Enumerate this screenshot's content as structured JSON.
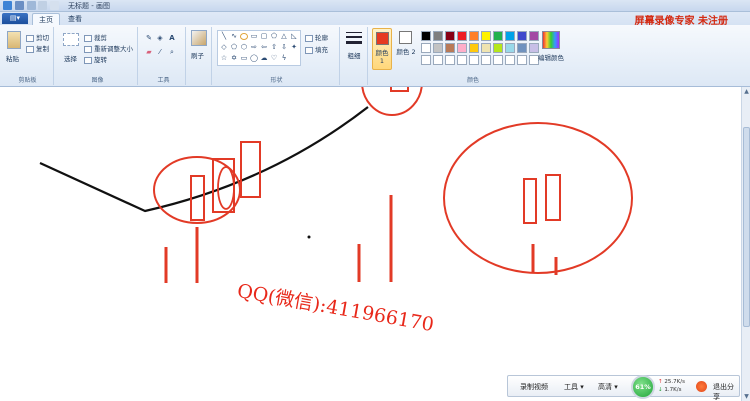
{
  "window": {
    "title": "无标题 - 画图",
    "watermark": "屏幕录像专家 未注册"
  },
  "tabs": [
    {
      "label": "主页",
      "active": true
    },
    {
      "label": "查看",
      "active": false
    }
  ],
  "ribbon": {
    "clipboard": {
      "label": "剪贴板",
      "paste": "粘贴",
      "cut": "剪切",
      "copy": "复制"
    },
    "image": {
      "label": "图像",
      "select": "选择",
      "crop": "裁剪",
      "resize": "重新调整大小",
      "rotate": "旋转"
    },
    "tools": {
      "label": "工具"
    },
    "brushes": "刷子",
    "shapes": {
      "label": "形状",
      "outline": "轮廓",
      "fill": "填充"
    },
    "size": "粗细",
    "color1": "颜色 1",
    "color2": "颜色 2",
    "colors": {
      "label": "颜色",
      "edit": "编辑颜色",
      "palette_row1": [
        "#000000",
        "#7f7f7f",
        "#880015",
        "#ed1c24",
        "#ff7f27",
        "#fff200",
        "#22b14c",
        "#00a2e8",
        "#3f48cc",
        "#a349a4"
      ],
      "palette_row2": [
        "#ffffff",
        "#c3c3c3",
        "#b97a57",
        "#ffaec9",
        "#ffc90e",
        "#efe4b0",
        "#b5e61d",
        "#99d9ea",
        "#7092be",
        "#c8bfe7"
      ],
      "accent_selected": "#e63a22"
    }
  },
  "canvas": {
    "watermark_text": "QQ(微信):411966170"
  },
  "recorder": {
    "record_video": "录制视频",
    "tools": "工具",
    "quality": "高清",
    "net_usage": "61%",
    "upload_speed": "25.7K/s",
    "download_speed": "1.7K/s",
    "exit": "退出分享"
  }
}
